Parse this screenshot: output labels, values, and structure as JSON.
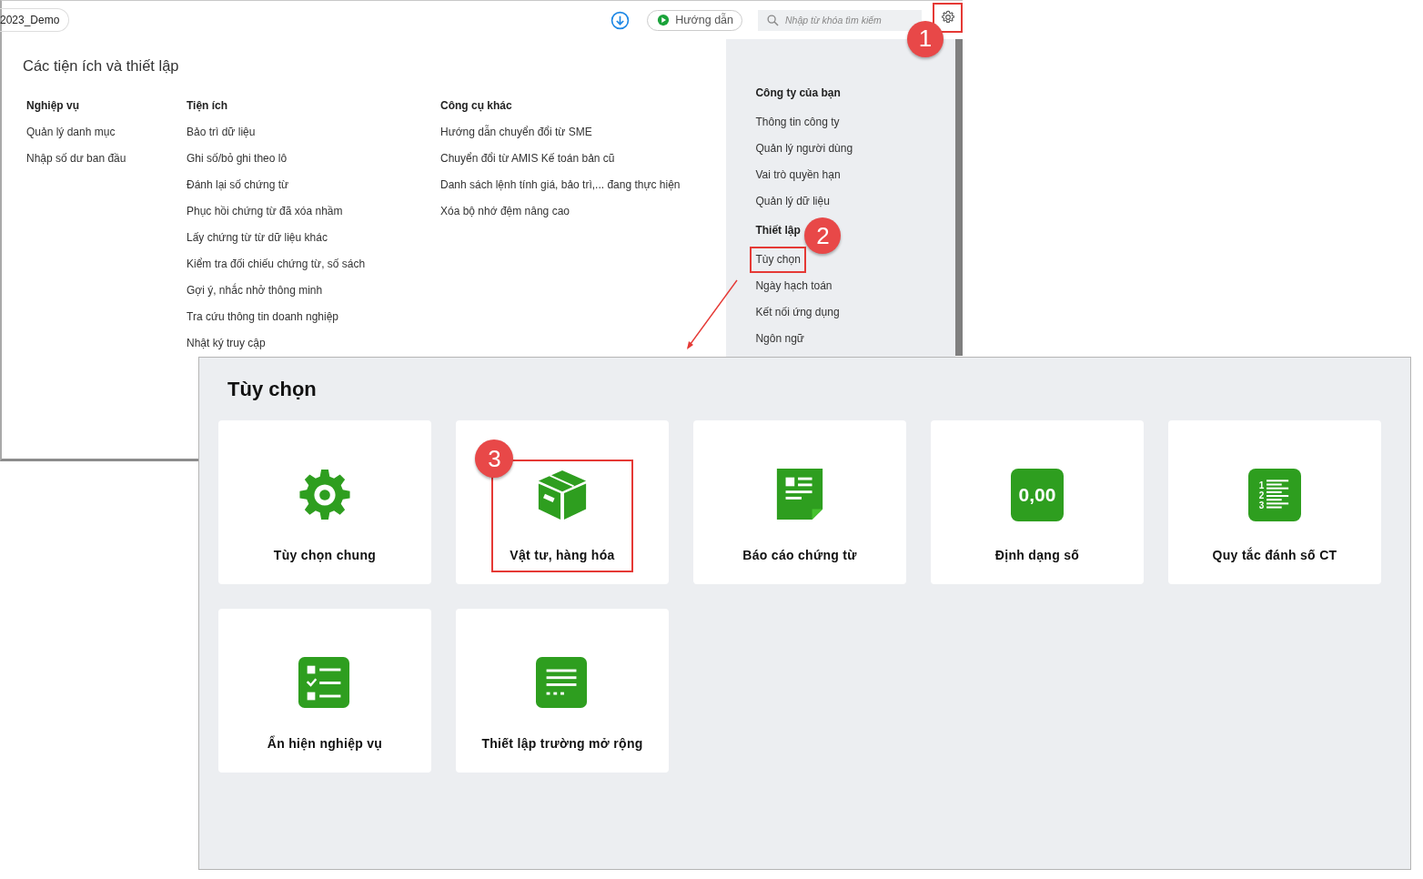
{
  "top_window": {
    "company": "2023_Demo",
    "toolbar": {
      "guide_button": "Hướng dẫn",
      "search": {
        "placeholder": "Nhập từ khóa tìm kiếm"
      },
      "settings": {
        "highlighted": true,
        "callout": "1"
      }
    },
    "title": "Các tiện ích và thiết lập",
    "columns": [
      {
        "heading": "Nghiệp vụ",
        "items": [
          "Quản lý danh mục",
          "Nhập số dư ban đầu"
        ]
      },
      {
        "heading": "Tiện ích",
        "items": [
          "Bảo trì dữ liệu",
          "Ghi số/bỏ ghi theo lô",
          "Đánh lại số chứng từ",
          "Phục hồi chứng từ đã xóa nhầm",
          "Lấy chứng từ từ dữ liệu khác",
          "Kiểm tra đối chiếu chứng từ, số sách",
          "Gợi ý, nhắc nhở thông minh",
          "Tra cứu thông tin doanh nghiệp",
          "Nhật ký truy cập"
        ]
      },
      {
        "heading": "Công cụ khác",
        "items": [
          "Hướng dẫn chuyển đổi từ SME",
          "Chuyển đổi từ AMIS Kế toán bản cũ",
          "Danh sách lệnh tính giá, bảo trì,... đang thực hiện",
          "Xóa bộ nhớ đệm nâng cao"
        ]
      }
    ],
    "side_panel": {
      "sections": [
        {
          "heading": "Công ty của bạn",
          "items": [
            {
              "label": "Thông tin công ty",
              "highlighted": false
            },
            {
              "label": "Quản lý người dùng",
              "highlighted": false
            },
            {
              "label": "Vai trò quyền hạn",
              "highlighted": false
            },
            {
              "label": "Quản lý dữ liệu",
              "highlighted": false
            }
          ]
        },
        {
          "heading": "Thiết lập",
          "items": [
            {
              "label": "Tùy chọn",
              "highlighted": true,
              "callout": "2"
            },
            {
              "label": "Ngày hạch toán",
              "highlighted": false
            },
            {
              "label": "Kết nối ứng dụng",
              "highlighted": false
            },
            {
              "label": "Ngôn ngữ",
              "highlighted": false
            }
          ]
        }
      ]
    }
  },
  "options_panel": {
    "title": "Tùy chọn",
    "cards": [
      {
        "label": "Tùy chọn chung",
        "kind": "gear",
        "highlighted": false
      },
      {
        "label": "Vật tư, hàng hóa",
        "kind": "box",
        "highlighted": true,
        "callout": "3"
      },
      {
        "label": "Báo cáo chứng từ",
        "kind": "report",
        "highlighted": false
      },
      {
        "label": "Định dạng số",
        "kind": "number",
        "icon_text": "0,00",
        "highlighted": false
      },
      {
        "label": "Quy tắc đánh số CT",
        "kind": "numbered-list",
        "icon_digits": [
          "1",
          "2",
          "3"
        ],
        "highlighted": false
      },
      {
        "label": "Ẩn hiện nghiệp vụ",
        "kind": "checklist",
        "highlighted": false
      },
      {
        "label": "Thiết lập trường mở rộng",
        "kind": "list",
        "highlighted": false
      }
    ]
  }
}
